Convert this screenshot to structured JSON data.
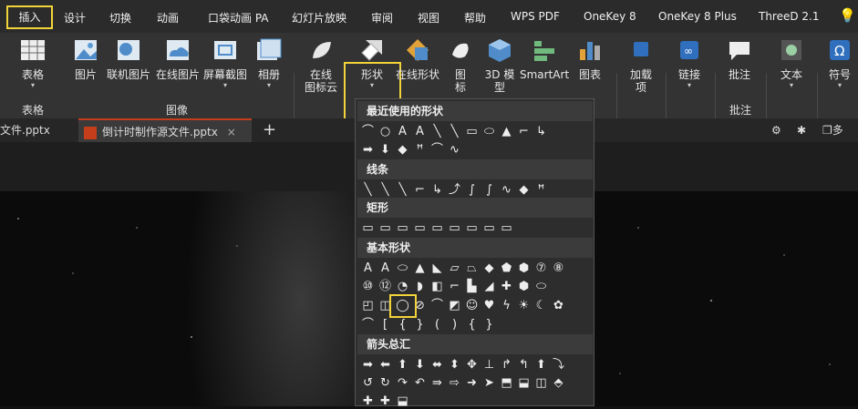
{
  "menu_tabs": [
    "插入",
    "设计",
    "切换",
    "动画",
    "口袋动画 PA",
    "幻灯片放映",
    "审阅",
    "视图",
    "帮助",
    "WPS PDF",
    "OneKey 8",
    "OneKey 8 Plus",
    "ThreeD 2.1"
  ],
  "ribbon": {
    "table": "表格",
    "picture": "图片",
    "online_picture": "联机图片",
    "online_picture2": "在线图片",
    "screenshot": "屏幕截图",
    "album": "相册",
    "online_icon_line1": "在线",
    "online_icon_line2": "图标云",
    "shapes": "形状",
    "online_shapes": "在线形状",
    "icon_line1": "图",
    "icon_line2": "标",
    "model_line1": "3D 模",
    "model_line2": "型",
    "smartart": "SmartArt",
    "chart": "图表",
    "addins_line1": "加载",
    "addins_line2": "项",
    "link": "链接",
    "comment": "批注",
    "text": "文本",
    "symbol": "符号"
  },
  "groups": {
    "table": "表格",
    "image": "图像",
    "comment": "批注"
  },
  "doc_tabs": {
    "first": "文件.pptx",
    "active": "倒计时制作源文件.pptx",
    "right": "多窗"
  },
  "dropdown": {
    "recent": "最近使用的形状",
    "lines": "线条",
    "rect": "矩形",
    "basic": "基本形状",
    "arrows": "箭头总汇",
    "recent_row1": [
      "⌒",
      "○",
      "A",
      "A",
      "╲",
      "╲",
      "▭",
      "⬭",
      "▲",
      "⌐",
      "↳"
    ],
    "recent_row2": [
      "➡",
      "⬇",
      "◆",
      "ꟸ",
      "⌒",
      "∿"
    ],
    "lines_row": [
      "╲",
      "╲",
      "╲",
      "⌐",
      "↳",
      "⤴",
      "∫",
      "∫",
      "∿",
      "◆",
      "ꟸ"
    ],
    "rect_row": [
      "▭",
      "▭",
      "▭",
      "▭",
      "▭",
      "▭",
      "▭",
      "▭",
      "▭"
    ],
    "basic_row1": [
      "A",
      "A",
      "⬭",
      "▲",
      "◣",
      "▱",
      "⏢",
      "◆",
      "⬟",
      "⬢",
      "⑦",
      "⑧"
    ],
    "basic_row2": [
      "⑩",
      "⑫",
      "◔",
      "◗",
      "◧",
      "⌐",
      "▙",
      "◢",
      "✚",
      "⬢",
      "⬭"
    ],
    "basic_row3": [
      "◰",
      "◫",
      "◯",
      "⊘",
      "⌒",
      "◩",
      "☺",
      "♥",
      "ϟ",
      "☀",
      "☾",
      "✿"
    ],
    "basic_row4": [
      "⌒",
      "[",
      "{",
      "}",
      "(",
      ")",
      "{",
      "}"
    ],
    "arrows_row1": [
      "➡",
      "⬅",
      "⬆",
      "⬇",
      "⬌",
      "⬍",
      "✥",
      "⊥",
      "↱",
      "↰",
      "⬆",
      "⤵"
    ],
    "arrows_row2": [
      "↺",
      "↻",
      "↷",
      "↶",
      "⇛",
      "⇨",
      "➜",
      "➤",
      "⬒",
      "⬓",
      "◫",
      "⬘"
    ],
    "arrows_row3": [
      "✚",
      "✚",
      "⬓"
    ]
  }
}
